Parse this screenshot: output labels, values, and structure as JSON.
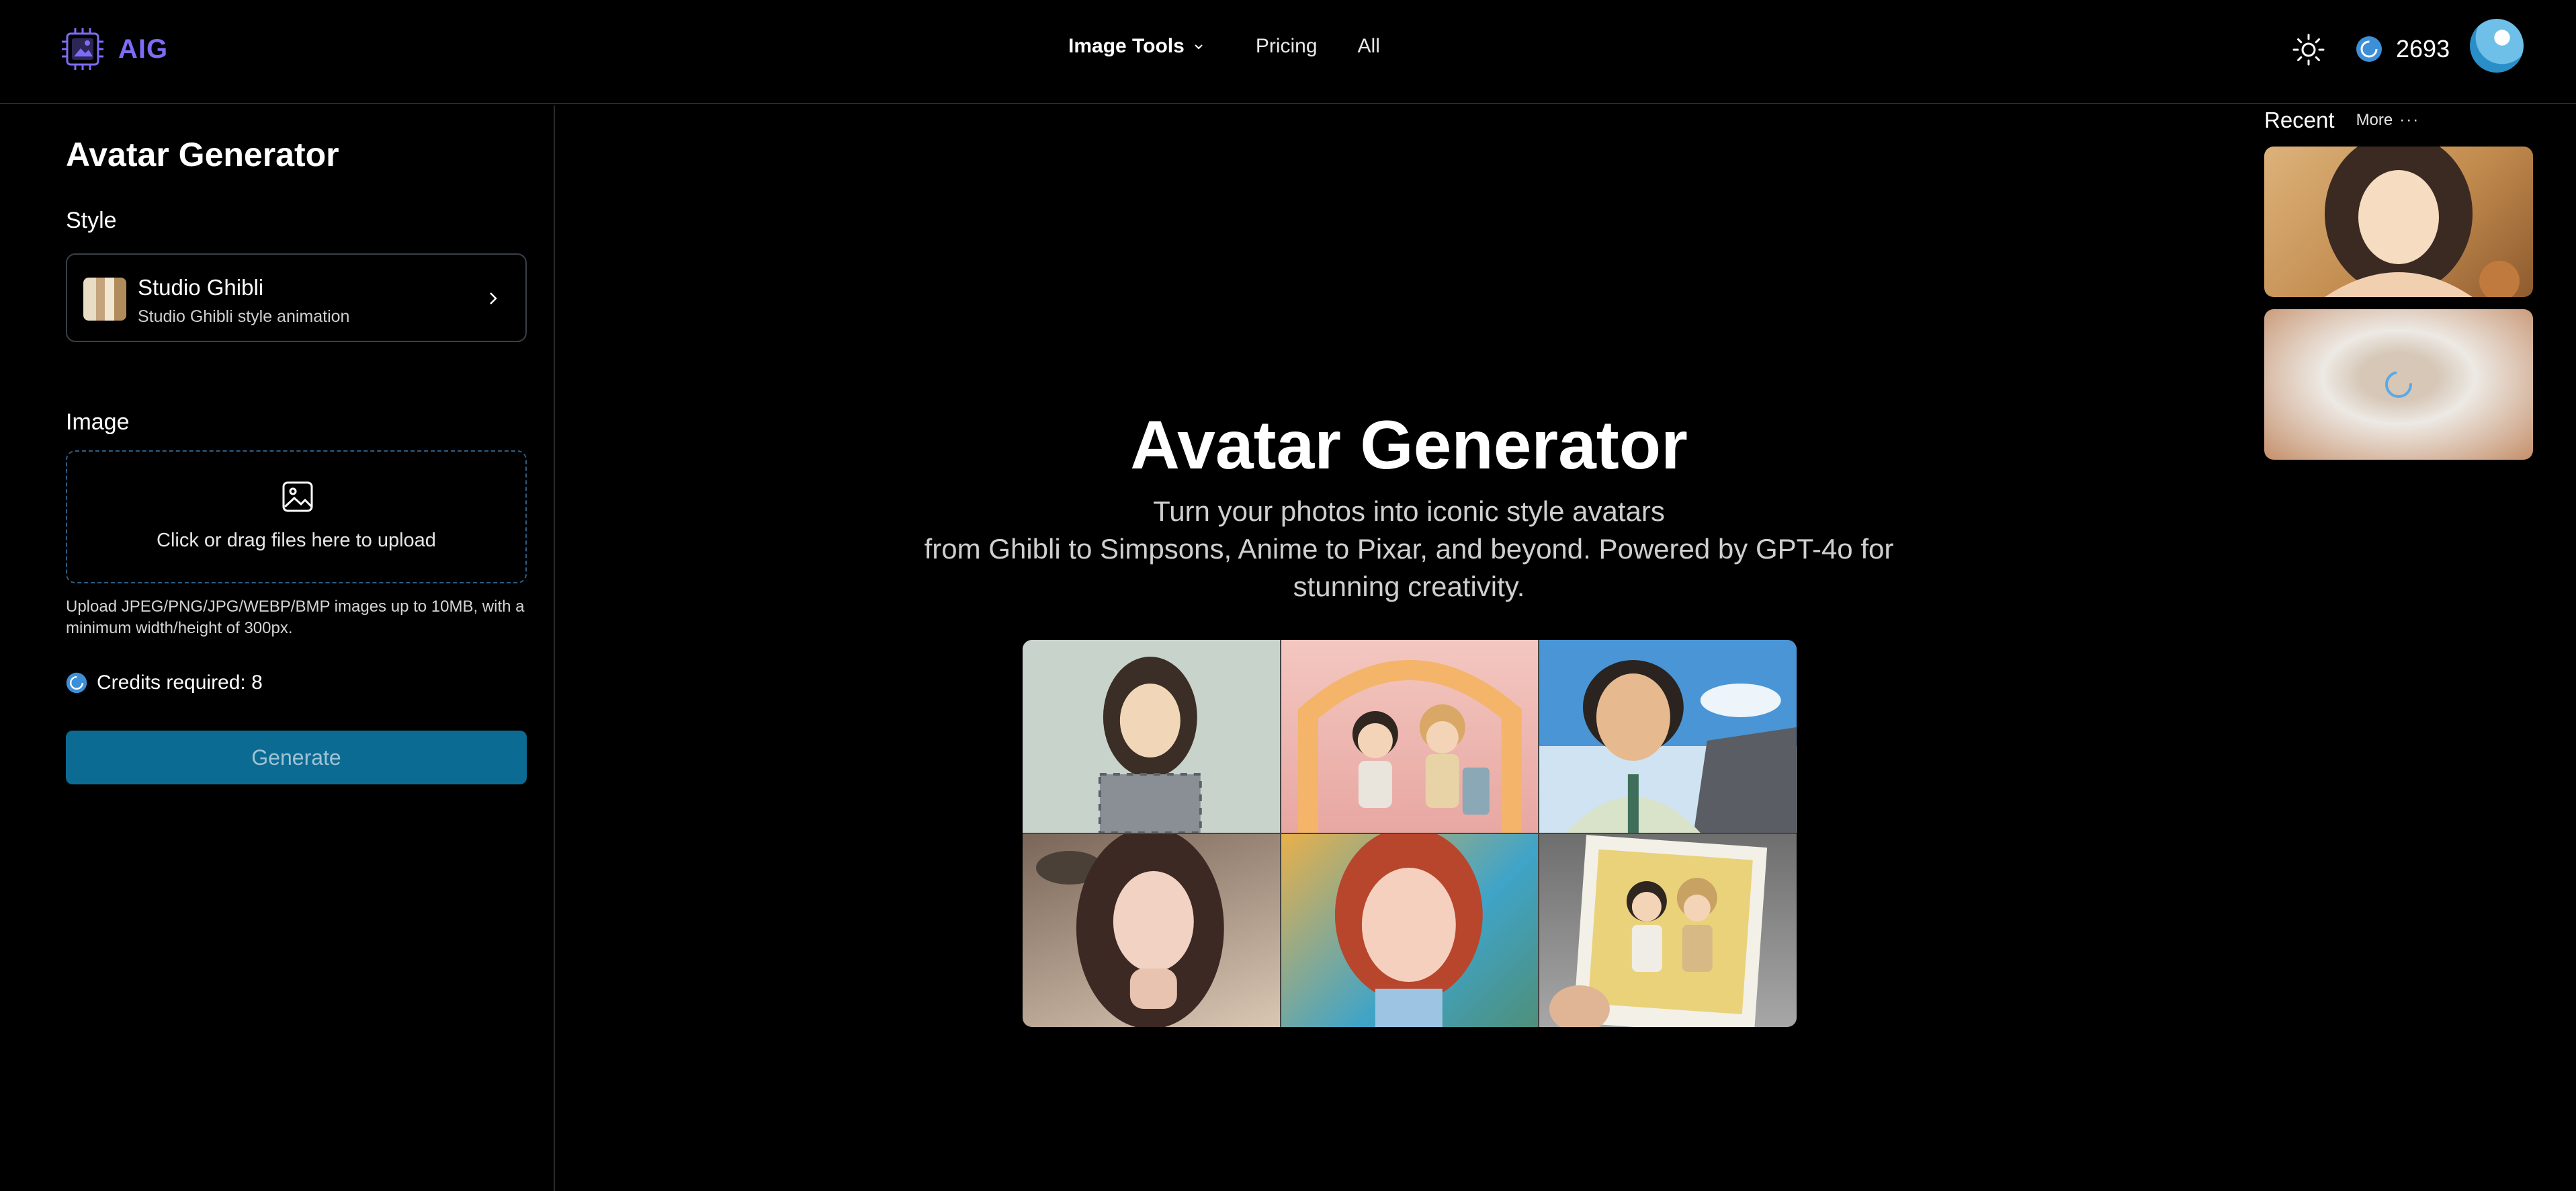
{
  "header": {
    "logo_text": "AIG",
    "nav": [
      {
        "label": "Image Tools",
        "has_dropdown": true
      },
      {
        "label": "Pricing"
      },
      {
        "label": "All"
      }
    ],
    "credits": "2693",
    "icons": {
      "theme": "sun-icon",
      "credits": "coin-icon",
      "avatar": "user-avatar"
    }
  },
  "left_panel": {
    "title": "Avatar Generator",
    "style_label": "Style",
    "style": {
      "name": "Studio Ghibli",
      "description": "Studio Ghibli style animation"
    },
    "image_label": "Image",
    "upload_text": "Click or drag files here to upload",
    "upload_hint": "Upload JPEG/PNG/JPG/WEBP/BMP images up to 10MB, with a minimum width/height of 300px.",
    "credits_required": "Credits required: 8",
    "generate_label": "Generate"
  },
  "hero": {
    "title": "Avatar Generator",
    "subtitle_line1": "Turn your photos into iconic style avatars",
    "subtitle_line2": "from Ghibli to Simpsons, Anime to Pixar, and beyond. Powered by GPT-4o for stunning creativity.",
    "gallery_count": 6
  },
  "recent": {
    "title": "Recent",
    "more_label": "More",
    "items": [
      {
        "state": "complete"
      },
      {
        "state": "loading"
      }
    ]
  },
  "colors": {
    "brand": "#7d6cf5",
    "primary_button": "#0c6b93",
    "background": "#000000",
    "border": "#2a2a2a"
  }
}
